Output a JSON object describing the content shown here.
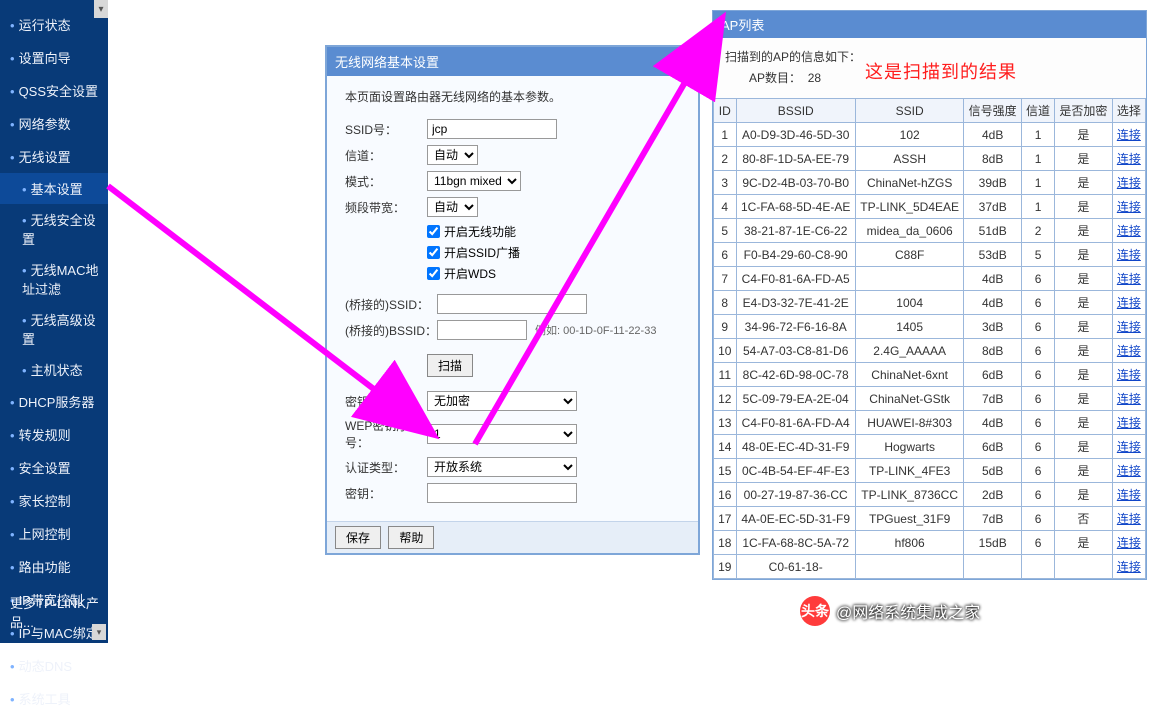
{
  "sidebar": {
    "items": [
      {
        "label": "运行状态"
      },
      {
        "label": "设置向导"
      },
      {
        "label": "QSS安全设置"
      },
      {
        "label": "网络参数"
      },
      {
        "label": "无线设置",
        "subs": [
          {
            "label": "基本设置",
            "active": true
          },
          {
            "label": "无线安全设置"
          },
          {
            "label": "无线MAC地址过滤"
          },
          {
            "label": "无线高级设置"
          },
          {
            "label": "主机状态"
          }
        ]
      },
      {
        "label": "DHCP服务器"
      },
      {
        "label": "转发规则"
      },
      {
        "label": "安全设置"
      },
      {
        "label": "家长控制"
      },
      {
        "label": "上网控制"
      },
      {
        "label": "路由功能"
      },
      {
        "label": "IP带宽控制"
      },
      {
        "label": "IP与MAC绑定"
      },
      {
        "label": "动态DNS"
      },
      {
        "label": "系统工具"
      }
    ],
    "footer": "更多TP-LINK产品..."
  },
  "panel": {
    "title": "无线网络基本设置",
    "desc": "本页面设置路由器无线网络的基本参数。",
    "ssid_label": "SSID号：",
    "ssid_value": "jcp",
    "channel_label": "信道：",
    "channel_value": "自动",
    "mode_label": "模式：",
    "mode_value": "11bgn mixed",
    "bw_label": "频段带宽：",
    "bw_value": "自动",
    "chk_wireless": "开启无线功能",
    "chk_ssid": "开启SSID广播",
    "chk_wds": "开启WDS",
    "bridge_ssid_label": "(桥接的)SSID：",
    "bridge_bssid_label": "(桥接的)BSSID：",
    "bssid_example": "例如: 00-1D-0F-11-22-33",
    "scan": "扫描",
    "enc_label": "密钥类型：",
    "enc_value": "无加密",
    "wep_label": "WEP密钥序号：",
    "wep_value": "1",
    "auth_label": "认证类型：",
    "auth_value": "开放系统",
    "key_label": "密钥：",
    "save": "保存",
    "help": "帮助"
  },
  "ap": {
    "title": "AP列表",
    "info": "扫描到的AP的信息如下：",
    "count_label": "AP数目：",
    "count_value": "28",
    "annot": "这是扫描到的结果",
    "headers": [
      "ID",
      "BSSID",
      "SSID",
      "信号强度",
      "信道",
      "是否加密",
      "选择"
    ],
    "link": "连接",
    "rows": [
      {
        "id": 1,
        "bssid": "A0-D9-3D-46-5D-30",
        "ssid": "102",
        "sig": "4dB",
        "ch": "1",
        "enc": "是"
      },
      {
        "id": 2,
        "bssid": "80-8F-1D-5A-EE-79",
        "ssid": "ASSH",
        "sig": "8dB",
        "ch": "1",
        "enc": "是"
      },
      {
        "id": 3,
        "bssid": "9C-D2-4B-03-70-B0",
        "ssid": "ChinaNet-hZGS",
        "sig": "39dB",
        "ch": "1",
        "enc": "是"
      },
      {
        "id": 4,
        "bssid": "1C-FA-68-5D-4E-AE",
        "ssid": "TP-LINK_5D4EAE",
        "sig": "37dB",
        "ch": "1",
        "enc": "是"
      },
      {
        "id": 5,
        "bssid": "38-21-87-1E-C6-22",
        "ssid": "midea_da_0606",
        "sig": "51dB",
        "ch": "2",
        "enc": "是"
      },
      {
        "id": 6,
        "bssid": "F0-B4-29-60-C8-90",
        "ssid": "C88F",
        "sig": "53dB",
        "ch": "5",
        "enc": "是"
      },
      {
        "id": 7,
        "bssid": "C4-F0-81-6A-FD-A5",
        "ssid": "",
        "sig": "4dB",
        "ch": "6",
        "enc": "是"
      },
      {
        "id": 8,
        "bssid": "E4-D3-32-7E-41-2E",
        "ssid": "1004",
        "sig": "4dB",
        "ch": "6",
        "enc": "是"
      },
      {
        "id": 9,
        "bssid": "34-96-72-F6-16-8A",
        "ssid": "1405",
        "sig": "3dB",
        "ch": "6",
        "enc": "是"
      },
      {
        "id": 10,
        "bssid": "54-A7-03-C8-81-D6",
        "ssid": "2.4G_AAAAA",
        "sig": "8dB",
        "ch": "6",
        "enc": "是"
      },
      {
        "id": 11,
        "bssid": "8C-42-6D-98-0C-78",
        "ssid": "ChinaNet-6xnt",
        "sig": "6dB",
        "ch": "6",
        "enc": "是"
      },
      {
        "id": 12,
        "bssid": "5C-09-79-EA-2E-04",
        "ssid": "ChinaNet-GStk",
        "sig": "7dB",
        "ch": "6",
        "enc": "是"
      },
      {
        "id": 13,
        "bssid": "C4-F0-81-6A-FD-A4",
        "ssid": "HUAWEI-8#303",
        "sig": "4dB",
        "ch": "6",
        "enc": "是"
      },
      {
        "id": 14,
        "bssid": "48-0E-EC-4D-31-F9",
        "ssid": "Hogwarts",
        "sig": "6dB",
        "ch": "6",
        "enc": "是"
      },
      {
        "id": 15,
        "bssid": "0C-4B-54-EF-4F-E3",
        "ssid": "TP-LINK_4FE3",
        "sig": "5dB",
        "ch": "6",
        "enc": "是"
      },
      {
        "id": 16,
        "bssid": "00-27-19-87-36-CC",
        "ssid": "TP-LINK_8736CC",
        "sig": "2dB",
        "ch": "6",
        "enc": "是"
      },
      {
        "id": 17,
        "bssid": "4A-0E-EC-5D-31-F9",
        "ssid": "TPGuest_31F9",
        "sig": "7dB",
        "ch": "6",
        "enc": "否"
      },
      {
        "id": 18,
        "bssid": "1C-FA-68-8C-5A-72",
        "ssid": "hf806",
        "sig": "15dB",
        "ch": "6",
        "enc": "是"
      },
      {
        "id": 19,
        "bssid": "C0-61-18-",
        "ssid": "",
        "sig": "",
        "ch": "",
        "enc": ""
      }
    ]
  },
  "watermark": {
    "badge": "头条",
    "text": "@网络系统集成之家"
  }
}
